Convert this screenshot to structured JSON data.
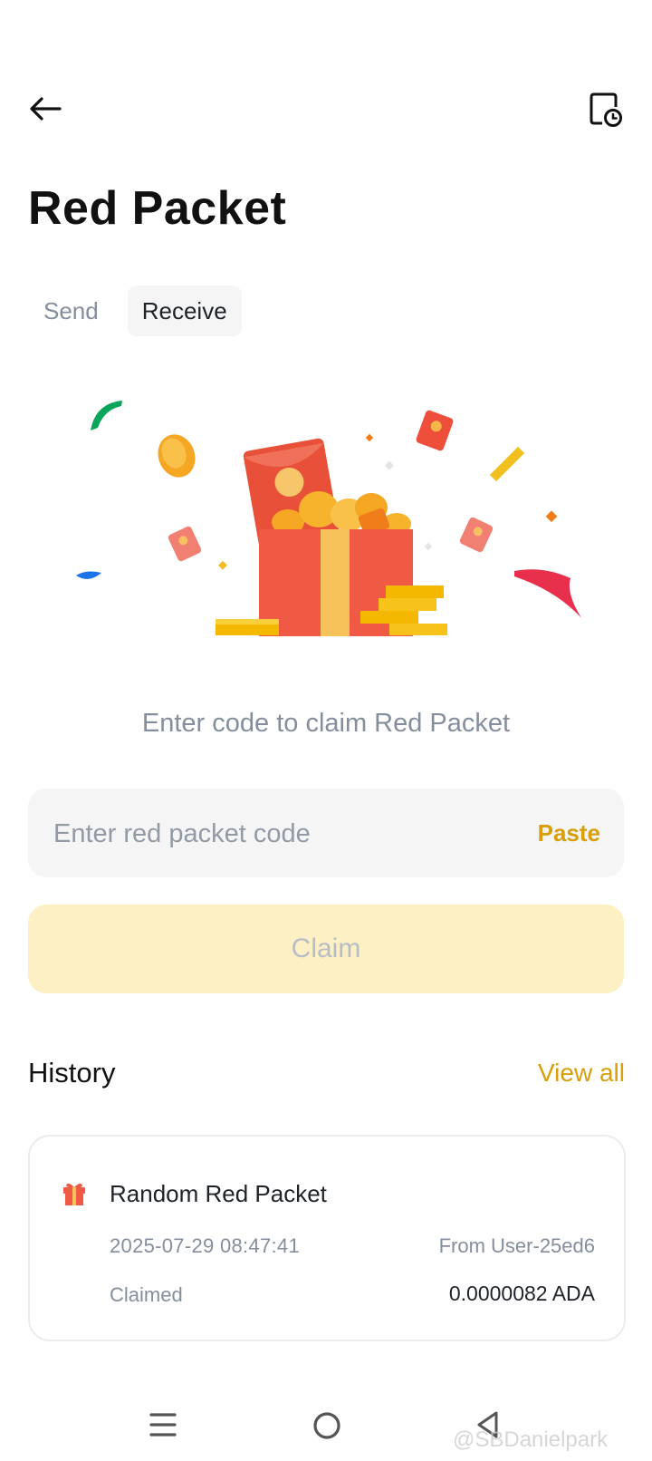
{
  "header": {
    "title": "Red Packet"
  },
  "tabs": [
    {
      "label": "Send",
      "active": false
    },
    {
      "label": "Receive",
      "active": true
    }
  ],
  "claim": {
    "hint": "Enter code to claim Red Packet",
    "input_placeholder": "Enter red packet code",
    "input_value": "",
    "paste_label": "Paste",
    "claim_label": "Claim"
  },
  "history": {
    "title": "History",
    "view_all_label": "View all",
    "items": [
      {
        "title": "Random Red Packet",
        "datetime": "2025-07-29 08:47:41",
        "from": "From User-25ed6",
        "status": "Claimed",
        "amount": "0.0000082 ADA",
        "icon": "gift-icon"
      }
    ]
  },
  "watermark": "@SBDanielpark",
  "colors": {
    "accent": "#d89f0b",
    "claim_button_bg": "#fcf0c4",
    "claim_button_text": "#b7bdc6",
    "input_bg": "#f5f5f5",
    "muted_text": "#848e9c"
  },
  "icons": {
    "back": "arrow-left-icon",
    "history": "document-clock-icon",
    "nav_menu": "menu-icon",
    "nav_home": "home-circle-icon",
    "nav_back": "triangle-back-icon"
  }
}
